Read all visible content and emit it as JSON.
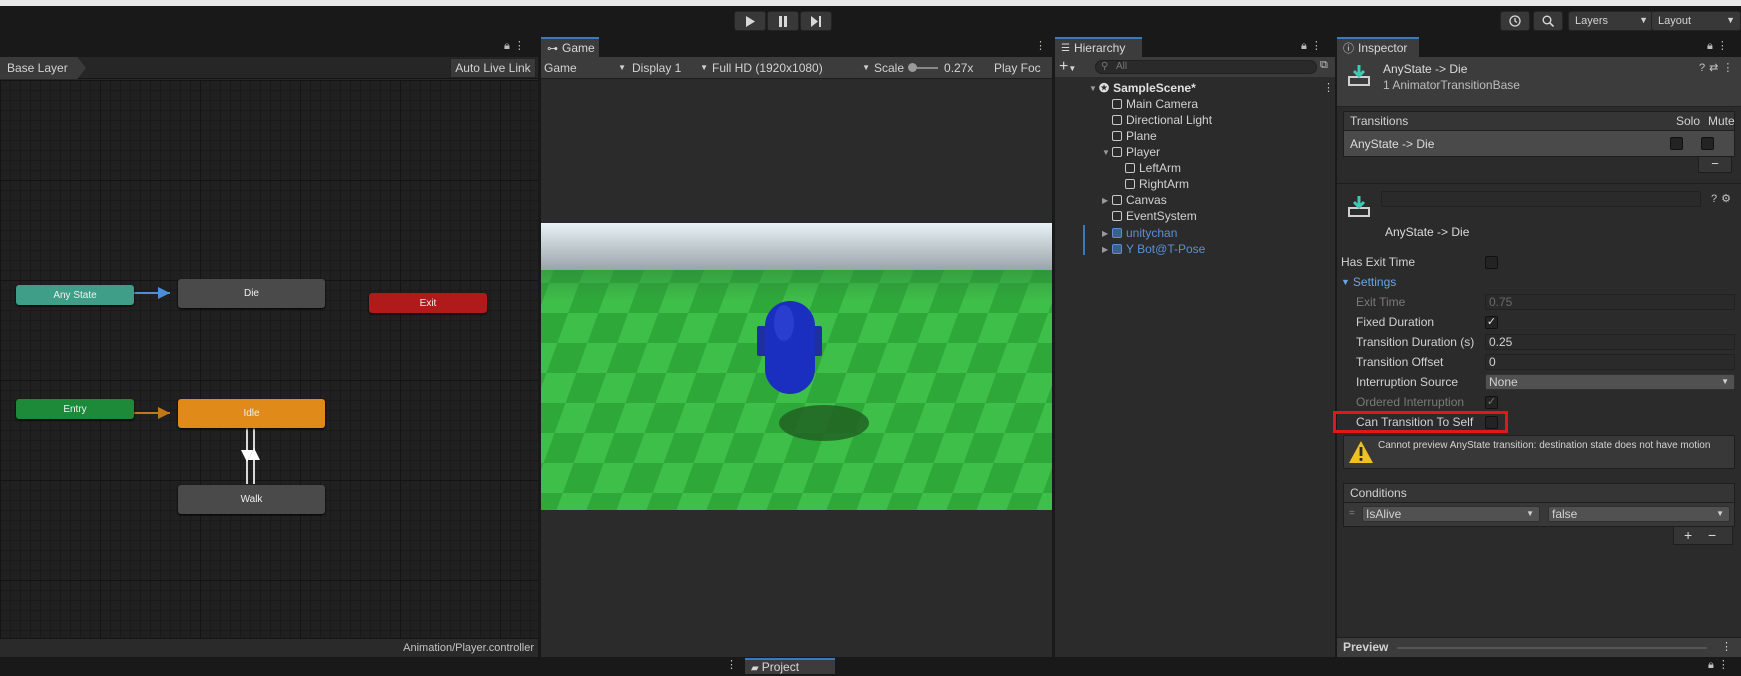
{
  "toolbar": {
    "layers_label": "Layers",
    "layout_label": "Layout"
  },
  "animator": {
    "base_layer": "Base Layer",
    "auto_live_link": "Auto Live Link",
    "footer_path": "Animation/Player.controller",
    "nodes": {
      "any_state": "Any State",
      "die": "Die",
      "exit": "Exit",
      "entry": "Entry",
      "idle": "Idle",
      "walk": "Walk"
    },
    "colors": {
      "any_state": "#3f9e87",
      "entry": "#1d8a3a",
      "exit": "#b11a1a",
      "idle": "#e08a1a",
      "default": "#4a4a4a"
    }
  },
  "game": {
    "tab_label": "Game",
    "mode": "Game",
    "display": "Display 1",
    "resolution": "Full HD (1920x1080)",
    "scale_label": "Scale",
    "scale_value": "0.27x",
    "play_focused": "Play Foc"
  },
  "hierarchy": {
    "tab_label": "Hierarchy",
    "search_placeholder": "All",
    "scene": "SampleScene*",
    "items": [
      {
        "name": "Main Camera"
      },
      {
        "name": "Directional Light"
      },
      {
        "name": "Plane"
      },
      {
        "name": "Player"
      },
      {
        "name": "LeftArm"
      },
      {
        "name": "RightArm"
      },
      {
        "name": "Canvas"
      },
      {
        "name": "EventSystem"
      },
      {
        "name": "unitychan"
      },
      {
        "name": "Y Bot@T-Pose"
      }
    ]
  },
  "inspector": {
    "tab_label": "Inspector",
    "title": "AnyState -> Die",
    "subtitle": "1 AnimatorTransitionBase",
    "transitions_header": "Transitions",
    "solo": "Solo",
    "mute": "Mute",
    "transition_row": "AnyState -> Die",
    "minus": "−",
    "transition_name_display": "AnyState -> Die",
    "has_exit_time": "Has Exit Time",
    "settings": "Settings",
    "exit_time_label": "Exit Time",
    "exit_time_value": "0.75",
    "fixed_duration": "Fixed Duration",
    "transition_duration_label": "Transition Duration (s)",
    "transition_duration_value": "0.25",
    "transition_offset_label": "Transition Offset",
    "transition_offset_value": "0",
    "interruption_source_label": "Interruption Source",
    "interruption_source_value": "None",
    "ordered_interruption": "Ordered Interruption",
    "can_transition_to_self": "Can Transition To Self",
    "warning": "Cannot preview AnyState transition:  destination state does not have motion",
    "conditions_header": "Conditions",
    "condition_param": "IsAlive",
    "condition_value": "false",
    "plus": "+",
    "preview": "Preview"
  },
  "project": {
    "tab_label": "Project"
  }
}
